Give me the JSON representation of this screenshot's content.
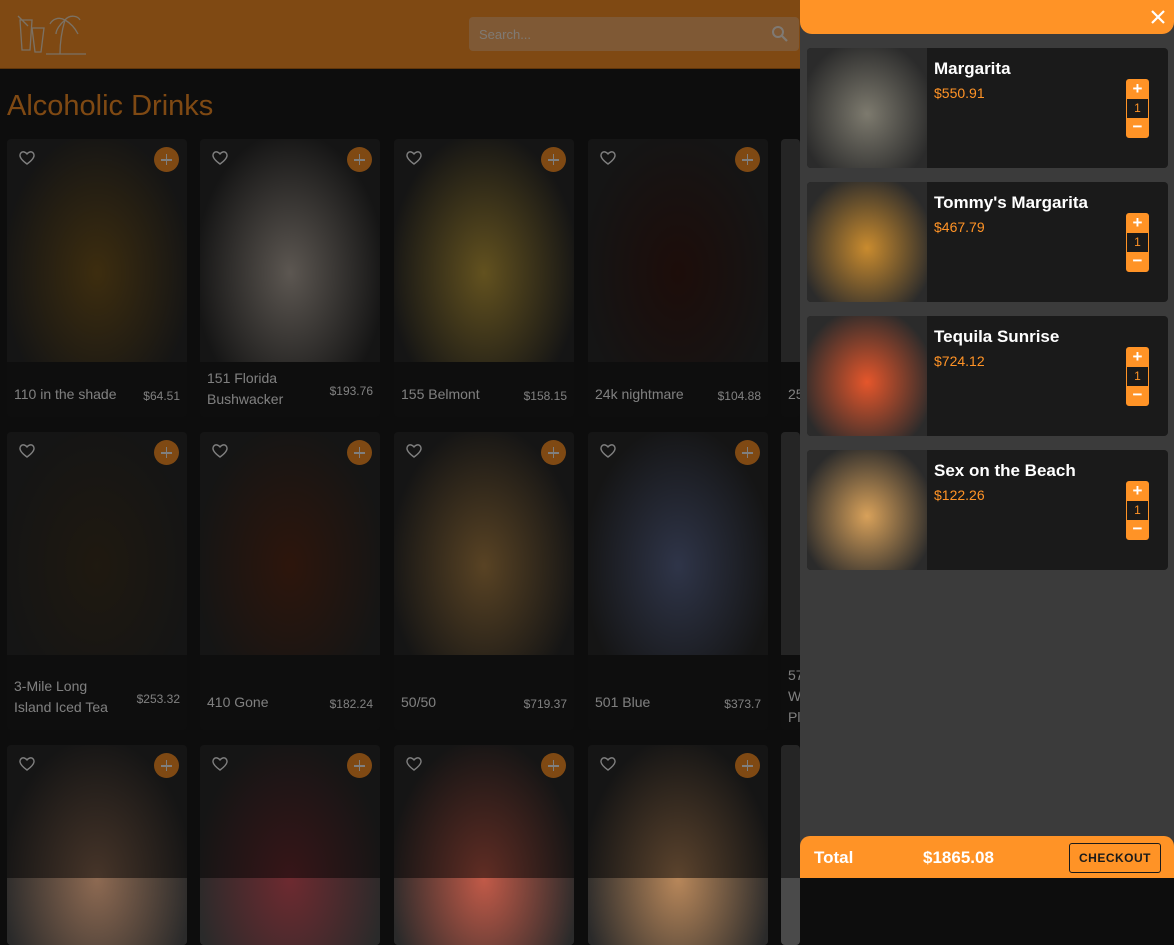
{
  "header": {
    "search_placeholder": "Search...",
    "colors": {
      "accent": "#ff9326"
    }
  },
  "page_title": "Alcoholic Drinks",
  "products": [
    {
      "name": "110 in the shade",
      "price": "$64.51",
      "swatch": "#7a5a1e"
    },
    {
      "name": "151 Florida Bushwacker",
      "price": "$193.76",
      "swatch": "#b9aea3"
    },
    {
      "name": "155 Belmont",
      "price": "$158.15",
      "swatch": "#c5a33e"
    },
    {
      "name": "24k nightmare",
      "price": "$104.88",
      "swatch": "#3a1a14"
    },
    {
      "name": "3-Mile Long Island Iced Tea",
      "price": "$253.32",
      "swatch": "#3e3220"
    },
    {
      "name": "410 Gone",
      "price": "$182.24",
      "swatch": "#5a2a18"
    },
    {
      "name": "50/50",
      "price": "$719.37",
      "swatch": "#b28648"
    },
    {
      "name": "501 Blue",
      "price": "$373.7",
      "swatch": "#5e6a92"
    },
    {
      "name": "",
      "price": "",
      "swatch": "#8e6a52"
    },
    {
      "name": "",
      "price": "",
      "swatch": "#6e2a30"
    },
    {
      "name": "",
      "price": "",
      "swatch": "#c25a48"
    },
    {
      "name": "",
      "price": "",
      "swatch": "#b8875a"
    }
  ],
  "partial_column": {
    "row1_text": "25",
    "row2_text": "57\nW\nPl"
  },
  "cart": {
    "items": [
      {
        "name": "Margarita",
        "price": "$550.91",
        "qty": "1",
        "swatch": "#7d7a6e"
      },
      {
        "name": "Tommy's Margarita",
        "price": "$467.79",
        "qty": "1",
        "swatch": "#c98b2e"
      },
      {
        "name": "Tequila Sunrise",
        "price": "$724.12",
        "qty": "1",
        "swatch": "#e5562b"
      },
      {
        "name": "Sex on the Beach",
        "price": "$122.26",
        "qty": "1",
        "swatch": "#d8a15a"
      }
    ],
    "total_label": "Total",
    "total_value": "$1865.08",
    "checkout_label": "CHECKOUT"
  }
}
